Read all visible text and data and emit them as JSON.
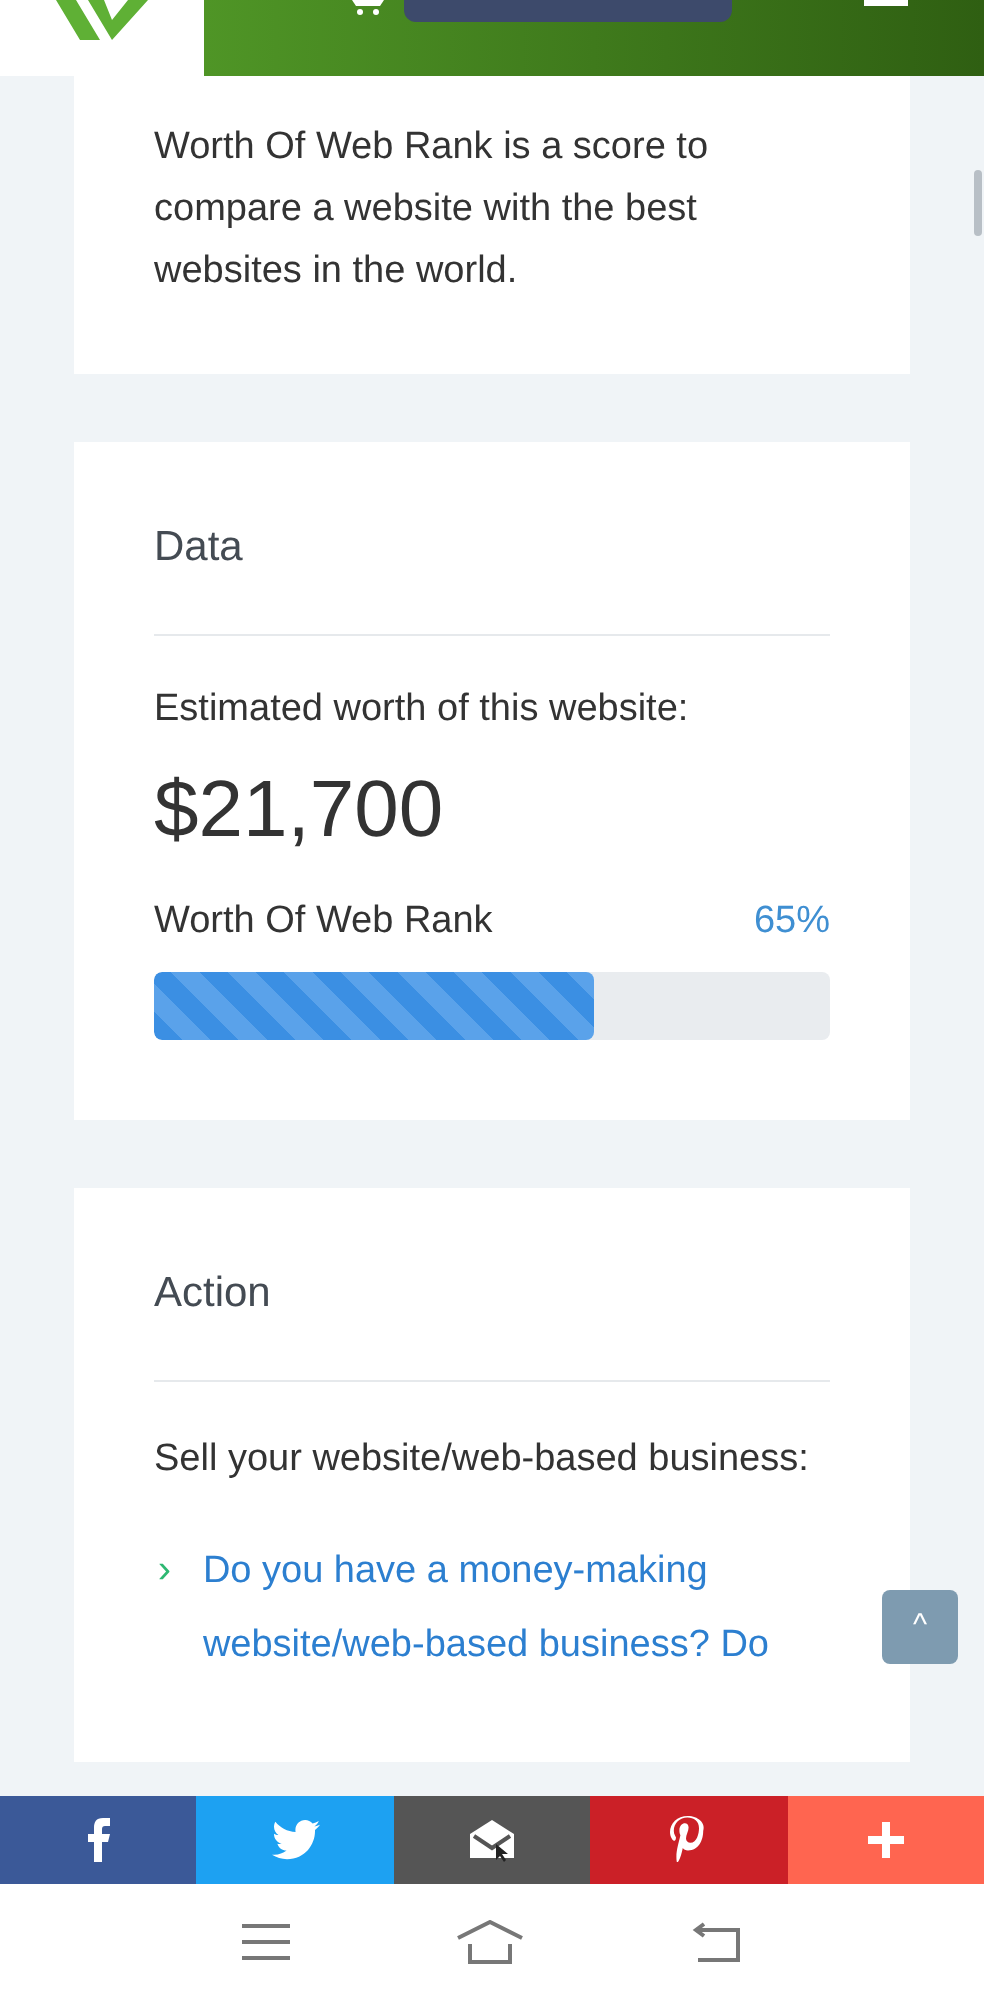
{
  "intro": {
    "text": "Worth Of Web Rank is a score to compare a website with the best websites in the world."
  },
  "data_card": {
    "title": "Data",
    "worth_label": "Estimated worth of this website:",
    "worth_value": "$21,700",
    "rank_label": "Worth Of Web Rank",
    "rank_percent": "65%",
    "level": 0.65
  },
  "action_card": {
    "title": "Action",
    "text": "Sell your website/web-based business:",
    "links": [
      {
        "marker": "›",
        "text": "Do you have a money-making website/web-based business? Do"
      }
    ]
  },
  "back_to_top": "^",
  "share_bar": [
    {
      "kind": "facebook",
      "color": "#3b5998"
    },
    {
      "kind": "twitter",
      "color": "#1da1f2"
    },
    {
      "kind": "email",
      "color": "#555555"
    },
    {
      "kind": "pinterest",
      "color": "#cb2027"
    },
    {
      "kind": "more",
      "color": "#ff6550"
    }
  ]
}
